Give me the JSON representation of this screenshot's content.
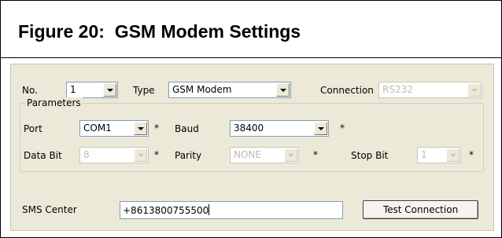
{
  "figure": {
    "title": "Figure 20:  GSM Modem Settings"
  },
  "dialog": {
    "no": {
      "label": "No.",
      "value": "1"
    },
    "type": {
      "label": "Type",
      "value": "GSM Modem"
    },
    "connection": {
      "label": "Connection",
      "value": "RS232",
      "enabled": false
    },
    "parameters": {
      "legend": "Parameters",
      "port": {
        "label": "Port",
        "value": "COM1",
        "required_mark": "*"
      },
      "baud": {
        "label": "Baud",
        "value": "38400",
        "required_mark": "*"
      },
      "data_bit": {
        "label": "Data Bit",
        "value": "8",
        "required_mark": "*",
        "enabled": false
      },
      "parity": {
        "label": "Parity",
        "value": "NONE",
        "required_mark": "*",
        "enabled": false
      },
      "stop_bit": {
        "label": "Stop Bit",
        "value": "1",
        "required_mark": "*",
        "enabled": false
      }
    },
    "sms_center": {
      "label": "SMS Center",
      "value": "+8613800755500"
    },
    "test_button": {
      "label": "Test Connection"
    }
  },
  "colors": {
    "dialog_bg": "#ece9d8",
    "input_border": "#7f9db9",
    "disabled_text": "#bdbbb0"
  }
}
